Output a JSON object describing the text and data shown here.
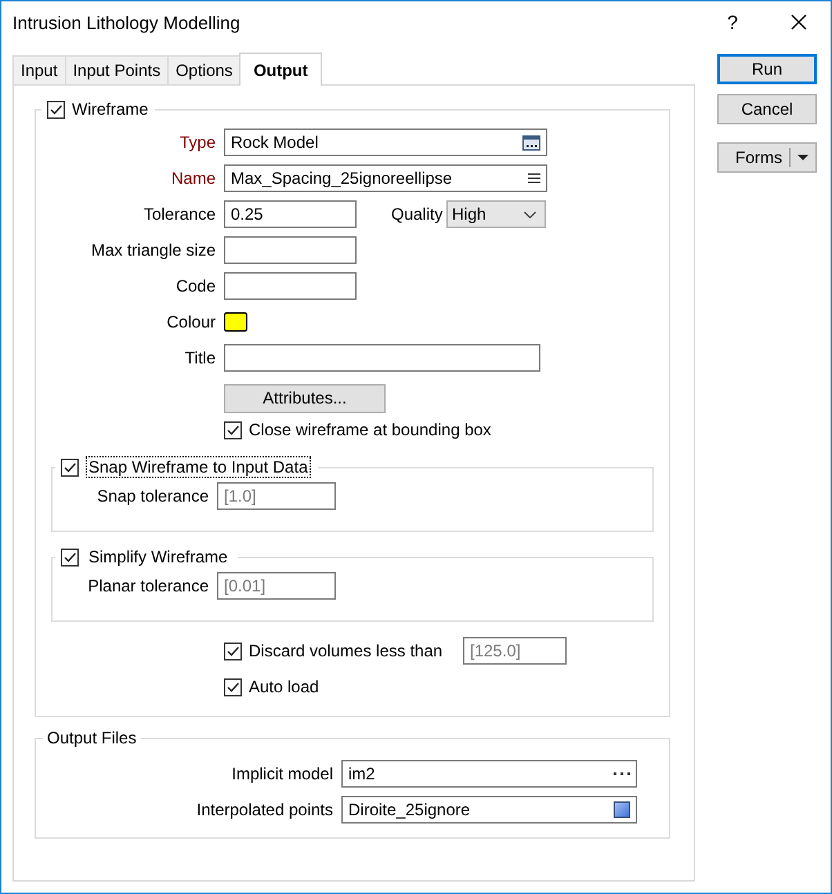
{
  "window": {
    "title": "Intrusion Lithology Modelling",
    "help": "?"
  },
  "tabs": [
    {
      "label": "Input",
      "selected": false
    },
    {
      "label": "Input Points",
      "selected": false
    },
    {
      "label": "Options",
      "selected": false
    },
    {
      "label": "Output",
      "selected": true
    }
  ],
  "wireframe": {
    "label": "Wireframe",
    "checked": true,
    "type": {
      "label": "Type",
      "required": true,
      "value": "Rock Model"
    },
    "name": {
      "label": "Name",
      "required": true,
      "value": "Max_Spacing_25ignoreellipse"
    },
    "tolerance": {
      "label": "Tolerance",
      "required": false,
      "value": "0.25"
    },
    "quality": {
      "label": "Quality",
      "value": "High"
    },
    "max_triangle_size": {
      "label": "Max triangle size",
      "required": false
    },
    "code": {
      "label": "Code",
      "required": false
    },
    "colour": {
      "label": "Colour",
      "color": "#ffff00"
    },
    "title": {
      "label": "Title",
      "required": false
    },
    "attributes_button": "Attributes...",
    "close_at_bounding_box": {
      "label": "Close wireframe at bounding box",
      "checked": true
    }
  },
  "snap": {
    "label": "Snap Wireframe to Input Data",
    "checked": true,
    "focused": true,
    "field": {
      "label": "Snap tolerance",
      "placeholder": "[1.0]"
    }
  },
  "simplify": {
    "label": "Simplify Wireframe",
    "checked": true,
    "focused": false,
    "field": {
      "label": "Planar tolerance",
      "placeholder": "[0.01]"
    }
  },
  "discard": {
    "label": "Discard volumes less than",
    "checked": true,
    "placeholder": "[125.0]"
  },
  "auto_load": {
    "label": "Auto load",
    "checked": true
  },
  "output_files": {
    "title": "Output Files",
    "implicit_model": {
      "label": "Implicit model",
      "value": "im2"
    },
    "interpolated_points": {
      "label": "Interpolated points",
      "value": "Diroite_25ignore"
    }
  },
  "buttons": [
    {
      "label": "Run",
      "default": true
    },
    {
      "label": "Cancel",
      "default": false
    }
  ],
  "forms": {
    "label": "Forms"
  }
}
